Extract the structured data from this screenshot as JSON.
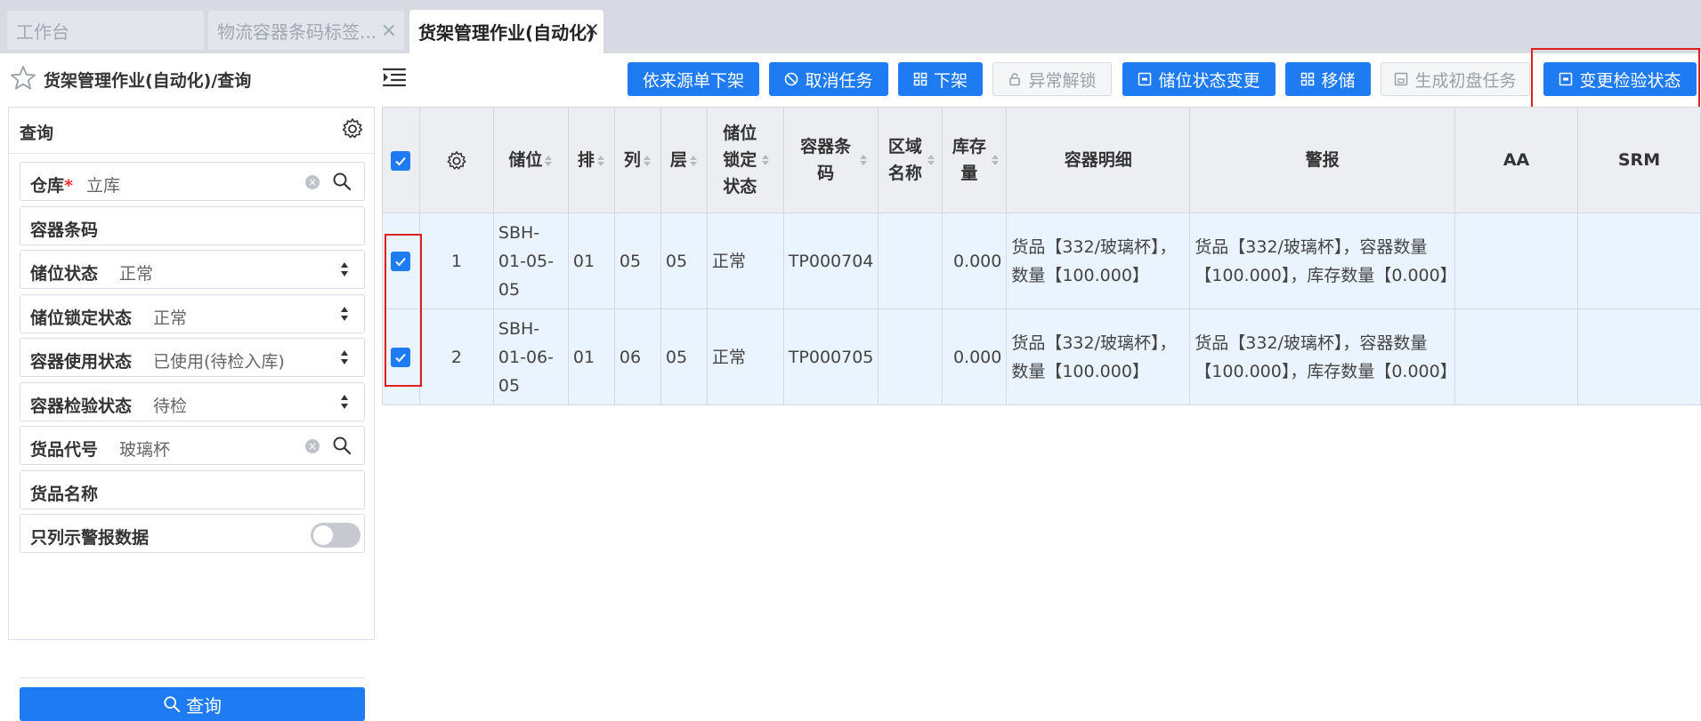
{
  "tabs": [
    {
      "label": "工作台"
    },
    {
      "label": "物流容器条码标签...",
      "close": "×"
    },
    {
      "label": "货架管理作业(自动化)",
      "close": "×"
    }
  ],
  "page": {
    "title": "货架管理作业(自动化)/查询"
  },
  "toolbar": {
    "buttons": [
      {
        "label": "依来源单下架",
        "enabled": true
      },
      {
        "label": "取消任务",
        "enabled": true,
        "icon": "ban-icon"
      },
      {
        "label": "下架",
        "enabled": true,
        "icon": "grid-icon"
      },
      {
        "label": "异常解锁",
        "enabled": false,
        "icon": "lock-icon"
      },
      {
        "label": "储位状态变更",
        "enabled": true,
        "icon": "square-icon"
      },
      {
        "label": "移储",
        "enabled": true,
        "icon": "grid-icon"
      },
      {
        "label": "生成初盘任务",
        "enabled": false,
        "icon": "save-icon"
      },
      {
        "label": "变更检验状态",
        "enabled": true,
        "icon": "square-icon"
      }
    ]
  },
  "query": {
    "title": "查询",
    "fields": [
      {
        "label": "仓库",
        "required": "*",
        "value": "立库"
      },
      {
        "label": "容器条码",
        "value": ""
      },
      {
        "label": "储位状态",
        "value": "正常"
      },
      {
        "label": "储位锁定状态",
        "value": "正常"
      },
      {
        "label": "容器使用状态",
        "value": "已使用(待检入库)"
      },
      {
        "label": "容器检验状态",
        "value": "待检"
      },
      {
        "label": "货品代号",
        "value": "玻璃杯"
      },
      {
        "label": "货品名称",
        "value": ""
      },
      {
        "label": "只列示警报数据",
        "value": ""
      }
    ],
    "alert_only": false,
    "search_label": "查询"
  },
  "grid": {
    "columns": [
      "储位",
      "排",
      "列",
      "层",
      "储位锁定状态",
      "容器条码",
      "区域名称",
      "库存量",
      "容器明细",
      "警报",
      "AA",
      "SRM"
    ],
    "rows": [
      {
        "checked": true,
        "no": "1",
        "cells": [
          "SBH-01-05-05",
          "01",
          "05",
          "05",
          "正常",
          "TP000704",
          "",
          "0.000",
          "货品【332/玻璃杯】，数量【100.000】",
          "货品【332/玻璃杯】，容器数量【100.000】，库存数量【0.000】",
          "",
          ""
        ]
      },
      {
        "checked": true,
        "no": "2",
        "cells": [
          "SBH-01-06-05",
          "01",
          "06",
          "05",
          "正常",
          "TP000705",
          "",
          "0.000",
          "货品【332/玻璃杯】，数量【100.000】",
          "货品【332/玻璃杯】，容器数量【100.000】，库存数量【0.000】",
          "",
          ""
        ]
      }
    ]
  },
  "colors": {
    "accent": "#1e7bf2",
    "highlight_box": "#e02020",
    "row_bg": "#e9f4fe"
  }
}
